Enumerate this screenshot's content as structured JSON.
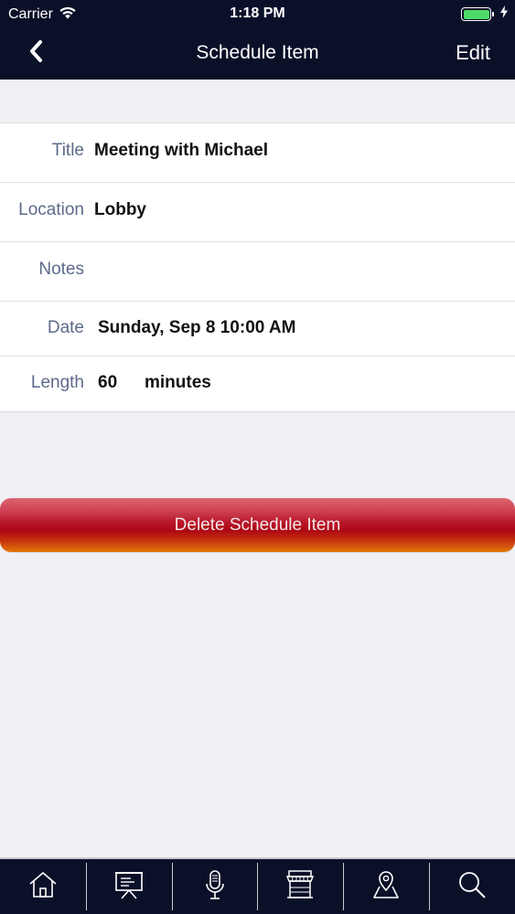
{
  "status_bar": {
    "carrier": "Carrier",
    "time": "1:18 PM",
    "battery_level": 1.0
  },
  "nav": {
    "back_icon": "chevron-left-icon",
    "title": "Schedule Item",
    "edit_label": "Edit"
  },
  "form": {
    "title": {
      "label": "Title",
      "value": "Meeting with Michael"
    },
    "location": {
      "label": "Location",
      "value": "Lobby"
    },
    "notes": {
      "label": "Notes",
      "value": ""
    },
    "date": {
      "label": "Date",
      "value": "Sunday, Sep 8 10:00 AM"
    },
    "length": {
      "label": "Length",
      "value": "60",
      "unit": "minutes"
    }
  },
  "delete_button": {
    "label": "Delete Schedule Item"
  },
  "tab_bar": {
    "tabs": [
      {
        "icon": "home-icon"
      },
      {
        "icon": "presentation-icon"
      },
      {
        "icon": "microphone-icon"
      },
      {
        "icon": "storefront-icon"
      },
      {
        "icon": "map-location-icon"
      },
      {
        "icon": "search-icon"
      }
    ]
  },
  "colors": {
    "nav_background": "#0b1029",
    "label_color": "#5d6a8b",
    "delete_red": "#b8172a",
    "battery_green": "#4cd964"
  }
}
